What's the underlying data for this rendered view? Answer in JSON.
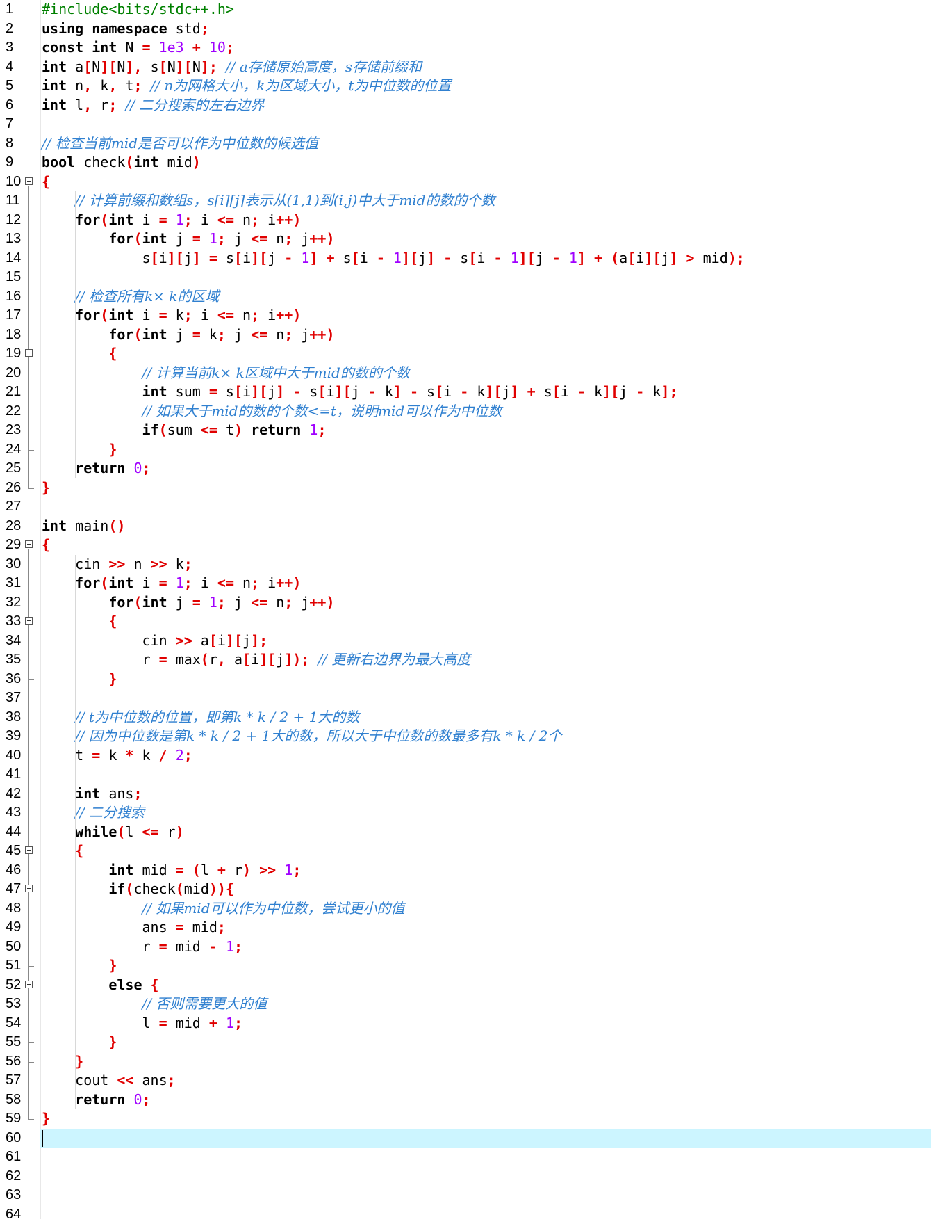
{
  "editor": {
    "current_line": 60,
    "lines": [
      {
        "n": "1",
        "html": "<span class=\"pp\">#include&lt;bits/stdc++.h&gt;</span>"
      },
      {
        "n": "2",
        "html": "<span class=\"kw\">using namespace</span> std<span class=\"sym\">;</span>"
      },
      {
        "n": "3",
        "html": "<span class=\"kw\">const int</span> N <span class=\"sym\">=</span> <span class=\"num-lit\">1e3</span> <span class=\"sym\">+</span> <span class=\"num-lit\">10</span><span class=\"sym\">;</span>"
      },
      {
        "n": "4",
        "html": "<span class=\"kw\">int</span> a<span class=\"sym\">[</span>N<span class=\"sym\">][</span>N<span class=\"sym\">],</span> s<span class=\"sym\">[</span>N<span class=\"sym\">][</span>N<span class=\"sym\">];</span> <span class=\"cm\">// a存储原始高度，s存储前缀和</span>"
      },
      {
        "n": "5",
        "html": "<span class=\"kw\">int</span> n<span class=\"sym\">,</span> k<span class=\"sym\">,</span> t<span class=\"sym\">;</span> <span class=\"cm\">// n为网格大小，k为区域大小，t为中位数的位置</span>"
      },
      {
        "n": "6",
        "html": "<span class=\"kw\">int</span> l<span class=\"sym\">,</span> r<span class=\"sym\">;</span> <span class=\"cm\">// 二分搜索的左右边界</span>"
      },
      {
        "n": "7",
        "html": ""
      },
      {
        "n": "8",
        "html": "<span class=\"cm\">// 检查当前mid是否可以作为中位数的候选值</span>"
      },
      {
        "n": "9",
        "html": "<span class=\"kw\">bool</span> check<span class=\"sym\">(</span><span class=\"kw\">int</span> mid<span class=\"sym\">)</span>"
      },
      {
        "n": "10",
        "html": "<span class=\"sym\">{</span>"
      },
      {
        "n": "11",
        "html": "    <span class=\"cm\">// 计算前缀和数组s，s[i][j]表示从(1,1)到(i,j)中大于mid的数的个数</span>"
      },
      {
        "n": "12",
        "html": "    <span class=\"kw\">for</span><span class=\"sym\">(</span><span class=\"kw\">int</span> i <span class=\"sym\">=</span> <span class=\"num-lit\">1</span><span class=\"sym\">;</span> i <span class=\"sym\">&lt;=</span> n<span class=\"sym\">;</span> i<span class=\"sym\">++)</span>"
      },
      {
        "n": "13",
        "html": "        <span class=\"kw\">for</span><span class=\"sym\">(</span><span class=\"kw\">int</span> j <span class=\"sym\">=</span> <span class=\"num-lit\">1</span><span class=\"sym\">;</span> j <span class=\"sym\">&lt;=</span> n<span class=\"sym\">;</span> j<span class=\"sym\">++)</span>"
      },
      {
        "n": "14",
        "html": "            s<span class=\"sym\">[</span>i<span class=\"sym\">][</span>j<span class=\"sym\">]</span> <span class=\"sym\">=</span> s<span class=\"sym\">[</span>i<span class=\"sym\">][</span>j <span class=\"sym\">-</span> <span class=\"num-lit\">1</span><span class=\"sym\">]</span> <span class=\"sym\">+</span> s<span class=\"sym\">[</span>i <span class=\"sym\">-</span> <span class=\"num-lit\">1</span><span class=\"sym\">][</span>j<span class=\"sym\">]</span> <span class=\"sym\">-</span> s<span class=\"sym\">[</span>i <span class=\"sym\">-</span> <span class=\"num-lit\">1</span><span class=\"sym\">][</span>j <span class=\"sym\">-</span> <span class=\"num-lit\">1</span><span class=\"sym\">]</span> <span class=\"sym\">+</span> <span class=\"sym\">(</span>a<span class=\"sym\">[</span>i<span class=\"sym\">][</span>j<span class=\"sym\">]</span> <span class=\"sym\">&gt;</span> mid<span class=\"sym\">);</span>"
      },
      {
        "n": "15",
        "html": ""
      },
      {
        "n": "16",
        "html": "    <span class=\"cm\">// 检查所有k× k的区域</span>"
      },
      {
        "n": "17",
        "html": "    <span class=\"kw\">for</span><span class=\"sym\">(</span><span class=\"kw\">int</span> i <span class=\"sym\">=</span> k<span class=\"sym\">;</span> i <span class=\"sym\">&lt;=</span> n<span class=\"sym\">;</span> i<span class=\"sym\">++)</span>"
      },
      {
        "n": "18",
        "html": "        <span class=\"kw\">for</span><span class=\"sym\">(</span><span class=\"kw\">int</span> j <span class=\"sym\">=</span> k<span class=\"sym\">;</span> j <span class=\"sym\">&lt;=</span> n<span class=\"sym\">;</span> j<span class=\"sym\">++)</span>"
      },
      {
        "n": "19",
        "html": "        <span class=\"sym\">{</span>"
      },
      {
        "n": "20",
        "html": "            <span class=\"cm\">// 计算当前k× k区域中大于mid的数的个数</span>"
      },
      {
        "n": "21",
        "html": "            <span class=\"kw\">int</span> sum <span class=\"sym\">=</span> s<span class=\"sym\">[</span>i<span class=\"sym\">][</span>j<span class=\"sym\">]</span> <span class=\"sym\">-</span> s<span class=\"sym\">[</span>i<span class=\"sym\">][</span>j <span class=\"sym\">-</span> k<span class=\"sym\">]</span> <span class=\"sym\">-</span> s<span class=\"sym\">[</span>i <span class=\"sym\">-</span> k<span class=\"sym\">][</span>j<span class=\"sym\">]</span> <span class=\"sym\">+</span> s<span class=\"sym\">[</span>i <span class=\"sym\">-</span> k<span class=\"sym\">][</span>j <span class=\"sym\">-</span> k<span class=\"sym\">];</span>"
      },
      {
        "n": "22",
        "html": "            <span class=\"cm\">// 如果大于mid的数的个数&lt;=t，说明mid可以作为中位数</span>"
      },
      {
        "n": "23",
        "html": "            <span class=\"kw\">if</span><span class=\"sym\">(</span>sum <span class=\"sym\">&lt;=</span> t<span class=\"sym\">)</span> <span class=\"kw\">return</span> <span class=\"num-lit\">1</span><span class=\"sym\">;</span>"
      },
      {
        "n": "24",
        "html": "        <span class=\"sym\">}</span>"
      },
      {
        "n": "25",
        "html": "    <span class=\"kw\">return</span> <span class=\"num-lit\">0</span><span class=\"sym\">;</span>"
      },
      {
        "n": "26",
        "html": "<span class=\"sym\">}</span>"
      },
      {
        "n": "27",
        "html": ""
      },
      {
        "n": "28",
        "html": "<span class=\"kw\">int</span> main<span class=\"sym\">()</span>"
      },
      {
        "n": "29",
        "html": "<span class=\"sym\">{</span>"
      },
      {
        "n": "30",
        "html": "    cin <span class=\"sym\">&gt;&gt;</span> n <span class=\"sym\">&gt;&gt;</span> k<span class=\"sym\">;</span>"
      },
      {
        "n": "31",
        "html": "    <span class=\"kw\">for</span><span class=\"sym\">(</span><span class=\"kw\">int</span> i <span class=\"sym\">=</span> <span class=\"num-lit\">1</span><span class=\"sym\">;</span> i <span class=\"sym\">&lt;=</span> n<span class=\"sym\">;</span> i<span class=\"sym\">++)</span>"
      },
      {
        "n": "32",
        "html": "        <span class=\"kw\">for</span><span class=\"sym\">(</span><span class=\"kw\">int</span> j <span class=\"sym\">=</span> <span class=\"num-lit\">1</span><span class=\"sym\">;</span> j <span class=\"sym\">&lt;=</span> n<span class=\"sym\">;</span> j<span class=\"sym\">++)</span>"
      },
      {
        "n": "33",
        "html": "        <span class=\"sym\">{</span>"
      },
      {
        "n": "34",
        "html": "            cin <span class=\"sym\">&gt;&gt;</span> a<span class=\"sym\">[</span>i<span class=\"sym\">][</span>j<span class=\"sym\">];</span>"
      },
      {
        "n": "35",
        "html": "            r <span class=\"sym\">=</span> max<span class=\"sym\">(</span>r<span class=\"sym\">,</span> a<span class=\"sym\">[</span>i<span class=\"sym\">][</span>j<span class=\"sym\">]);</span> <span class=\"cm\">// 更新右边界为最大高度</span>"
      },
      {
        "n": "36",
        "html": "        <span class=\"sym\">}</span>"
      },
      {
        "n": "37",
        "html": ""
      },
      {
        "n": "38",
        "html": "    <span class=\"cm\">// t为中位数的位置，即第k * k / 2 + 1大的数</span>"
      },
      {
        "n": "39",
        "html": "    <span class=\"cm\">// 因为中位数是第k * k / 2 + 1大的数，所以大于中位数的数最多有k * k / 2个</span>"
      },
      {
        "n": "40",
        "html": "    t <span class=\"sym\">=</span> k <span class=\"sym\">*</span> k <span class=\"sym\">/</span> <span class=\"num-lit\">2</span><span class=\"sym\">;</span>"
      },
      {
        "n": "41",
        "html": ""
      },
      {
        "n": "42",
        "html": "    <span class=\"kw\">int</span> ans<span class=\"sym\">;</span>"
      },
      {
        "n": "43",
        "html": "    <span class=\"cm\">// 二分搜索</span>"
      },
      {
        "n": "44",
        "html": "    <span class=\"kw\">while</span><span class=\"sym\">(</span>l <span class=\"sym\">&lt;=</span> r<span class=\"sym\">)</span>"
      },
      {
        "n": "45",
        "html": "    <span class=\"sym\">{</span>"
      },
      {
        "n": "46",
        "html": "        <span class=\"kw\">int</span> mid <span class=\"sym\">=</span> <span class=\"sym\">(</span>l <span class=\"sym\">+</span> r<span class=\"sym\">)</span> <span class=\"sym\">&gt;&gt;</span> <span class=\"num-lit\">1</span><span class=\"sym\">;</span>"
      },
      {
        "n": "47",
        "html": "        <span class=\"kw\">if</span><span class=\"sym\">(</span>check<span class=\"sym\">(</span>mid<span class=\"sym\">)){</span>"
      },
      {
        "n": "48",
        "html": "            <span class=\"cm\">// 如果mid可以作为中位数，尝试更小的值</span>"
      },
      {
        "n": "49",
        "html": "            ans <span class=\"sym\">=</span> mid<span class=\"sym\">;</span>"
      },
      {
        "n": "50",
        "html": "            r <span class=\"sym\">=</span> mid <span class=\"sym\">-</span> <span class=\"num-lit\">1</span><span class=\"sym\">;</span>"
      },
      {
        "n": "51",
        "html": "        <span class=\"sym\">}</span>"
      },
      {
        "n": "52",
        "html": "        <span class=\"kw\">else</span> <span class=\"sym\">{</span>"
      },
      {
        "n": "53",
        "html": "            <span class=\"cm\">// 否则需要更大的值</span>"
      },
      {
        "n": "54",
        "html": "            l <span class=\"sym\">=</span> mid <span class=\"sym\">+</span> <span class=\"num-lit\">1</span><span class=\"sym\">;</span>"
      },
      {
        "n": "55",
        "html": "        <span class=\"sym\">}</span>"
      },
      {
        "n": "56",
        "html": "    <span class=\"sym\">}</span>"
      },
      {
        "n": "57",
        "html": "    cout <span class=\"sym\">&lt;&lt;</span> ans<span class=\"sym\">;</span>"
      },
      {
        "n": "58",
        "html": "    <span class=\"kw\">return</span> <span class=\"num-lit\">0</span><span class=\"sym\">;</span>"
      },
      {
        "n": "59",
        "html": "<span class=\"sym\">}</span>"
      },
      {
        "n": "60",
        "html": ""
      },
      {
        "n": "61",
        "html": ""
      },
      {
        "n": "62",
        "html": ""
      },
      {
        "n": "63",
        "html": ""
      },
      {
        "n": "64",
        "html": ""
      }
    ],
    "fold_markers": [
      10,
      19,
      29,
      33,
      45,
      47,
      52
    ],
    "colors": {
      "keyword": "#000000",
      "preprocessor": "#008000",
      "number": "#a000ff",
      "operator": "#e00000",
      "comment": "#3080d0",
      "current_line_bg": "#ccf5ff"
    }
  }
}
